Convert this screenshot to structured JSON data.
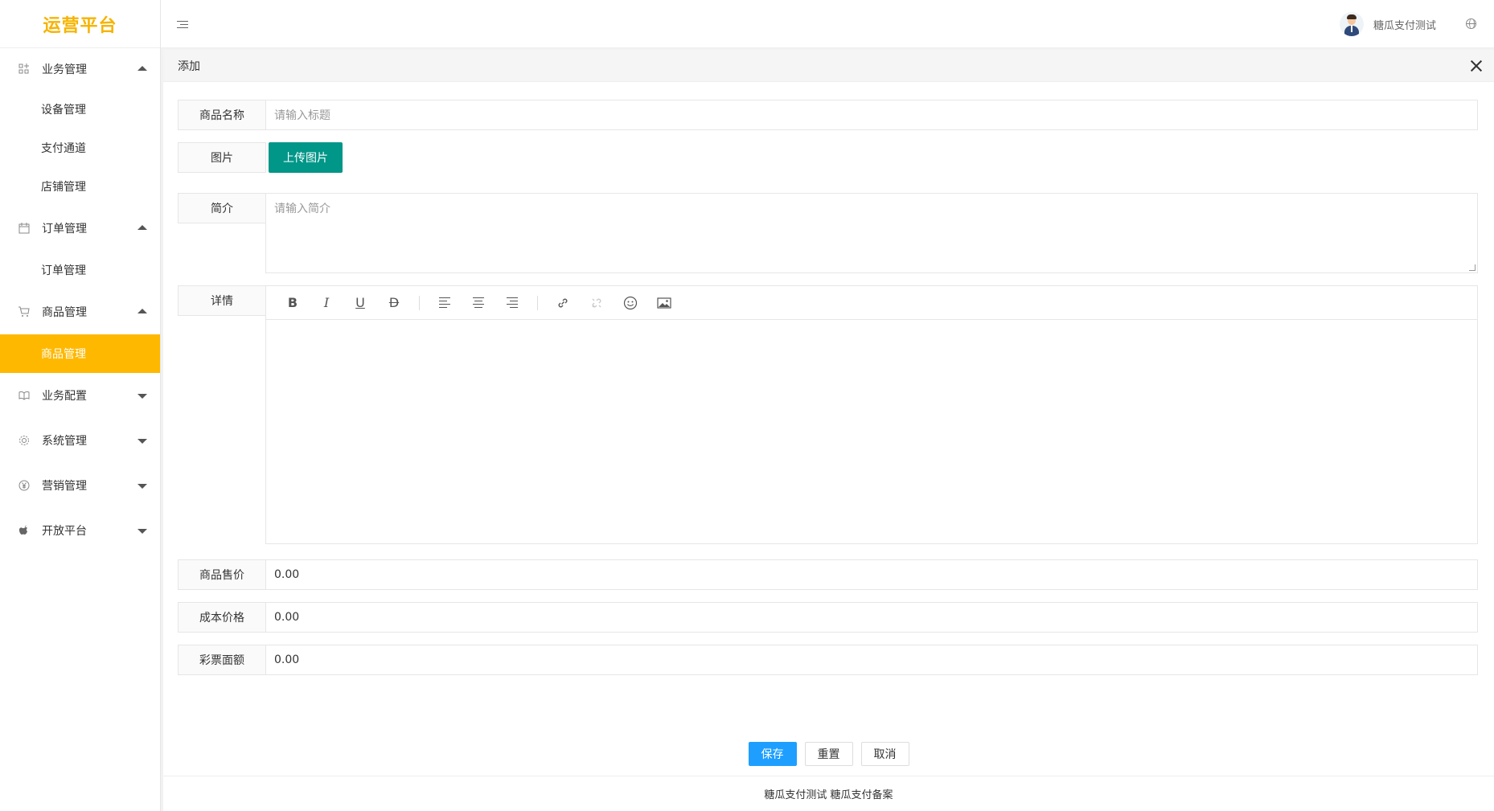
{
  "app": {
    "title": "运营平台"
  },
  "sidebar": {
    "groups": [
      {
        "label": "业务管理",
        "icon": "grid-plus-icon",
        "expanded": true,
        "items": [
          "设备管理",
          "支付通道",
          "店铺管理"
        ]
      },
      {
        "label": "订单管理",
        "icon": "calendar-icon",
        "expanded": true,
        "items": [
          "订单管理"
        ]
      },
      {
        "label": "商品管理",
        "icon": "cart-icon",
        "expanded": true,
        "items": [
          "商品管理"
        ],
        "active_item": "商品管理"
      },
      {
        "label": "业务配置",
        "icon": "book-icon",
        "expanded": false
      },
      {
        "label": "系统管理",
        "icon": "gear-icon",
        "expanded": false
      },
      {
        "label": "营销管理",
        "icon": "yen-icon",
        "expanded": false
      },
      {
        "label": "开放平台",
        "icon": "apple-icon",
        "expanded": false
      }
    ],
    "active_color": "#ffb800"
  },
  "header": {
    "user_name": "糖瓜支付测试"
  },
  "dialog": {
    "title": "添加",
    "fields": {
      "name": {
        "label": "商品名称",
        "placeholder": "请输入标题"
      },
      "image": {
        "label": "图片",
        "button": "上传图片"
      },
      "intro": {
        "label": "简介",
        "placeholder": "请输入简介"
      },
      "detail": {
        "label": "详情"
      },
      "price": {
        "label": "商品售价",
        "value": "0.00"
      },
      "cost": {
        "label": "成本价格",
        "value": "0.00"
      },
      "lottery": {
        "label": "彩票面额",
        "value": "0.00"
      }
    },
    "buttons": {
      "save": "保存",
      "reset": "重置",
      "cancel": "取消"
    }
  },
  "footer": {
    "text": "糖瓜支付测试 糖瓜支付备案"
  },
  "colors": {
    "brand": "#f7b300",
    "upload": "#009688",
    "primary": "#1e9fff"
  }
}
